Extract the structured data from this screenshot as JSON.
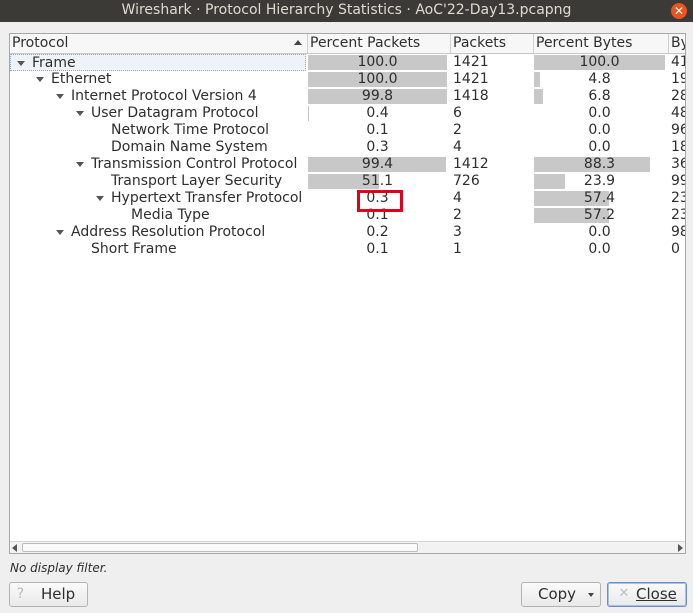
{
  "window": {
    "title": "Wireshark · Protocol Hierarchy Statistics · AoC'22-Day13.pcapng"
  },
  "columns": {
    "protocol": "Protocol",
    "percent_packets": "Percent Packets",
    "packets": "Packets",
    "percent_bytes": "Percent Bytes",
    "bytes": "By"
  },
  "rows": [
    {
      "name": "Frame",
      "pct_packets": "100.0",
      "packets": "1421",
      "pct_bytes": "100.0",
      "bytes": "41",
      "pp_fill": 1.0,
      "pb_fill": 1.0
    },
    {
      "name": "Ethernet",
      "pct_packets": "100.0",
      "packets": "1421",
      "pct_bytes": "4.8",
      "bytes": "19",
      "pp_fill": 1.0,
      "pb_fill": 0.048
    },
    {
      "name": "Internet Protocol Version 4",
      "pct_packets": "99.8",
      "packets": "1418",
      "pct_bytes": "6.8",
      "bytes": "28",
      "pp_fill": 0.998,
      "pb_fill": 0.068
    },
    {
      "name": "User Datagram Protocol",
      "pct_packets": "0.4",
      "packets": "6",
      "pct_bytes": "0.0",
      "bytes": "48",
      "pp_fill": 0.004,
      "pb_fill": 0.0
    },
    {
      "name": "Network Time Protocol",
      "pct_packets": "0.1",
      "packets": "2",
      "pct_bytes": "0.0",
      "bytes": "96",
      "pp_fill": 0.001,
      "pb_fill": 0.0
    },
    {
      "name": "Domain Name System",
      "pct_packets": "0.3",
      "packets": "4",
      "pct_bytes": "0.0",
      "bytes": "18",
      "pp_fill": 0.003,
      "pb_fill": 0.0
    },
    {
      "name": "Transmission Control Protocol",
      "pct_packets": "99.4",
      "packets": "1412",
      "pct_bytes": "88.3",
      "bytes": "36",
      "pp_fill": 0.994,
      "pb_fill": 0.883
    },
    {
      "name": "Transport Layer Security",
      "pct_packets": "51.1",
      "packets": "726",
      "pct_bytes": "23.9",
      "bytes": "99",
      "pp_fill": 0.511,
      "pb_fill": 0.239
    },
    {
      "name": "Hypertext Transfer Protocol",
      "pct_packets": "0.3",
      "packets": "4",
      "pct_bytes": "57.4",
      "bytes": "23",
      "pp_fill": 0.003,
      "pb_fill": 0.574
    },
    {
      "name": "Media Type",
      "pct_packets": "0.1",
      "packets": "2",
      "pct_bytes": "57.2",
      "bytes": "23",
      "pp_fill": 0.001,
      "pb_fill": 0.572
    },
    {
      "name": "Address Resolution Protocol",
      "pct_packets": "0.2",
      "packets": "3",
      "pct_bytes": "0.0",
      "bytes": "98",
      "pp_fill": 0.002,
      "pb_fill": 0.0
    },
    {
      "name": "Short Frame",
      "pct_packets": "0.1",
      "packets": "1",
      "pct_bytes": "0.0",
      "bytes": "0",
      "pp_fill": 0.001,
      "pb_fill": 0.0
    }
  ],
  "status": {
    "filter_text": "No display filter."
  },
  "buttons": {
    "help": "Help",
    "copy": "Copy",
    "close": "Close"
  },
  "colors": {
    "bar": "#c8c8c8",
    "highlight": "#e0001b",
    "titlebar": "#3b3a36",
    "close_button": "#e95420"
  }
}
